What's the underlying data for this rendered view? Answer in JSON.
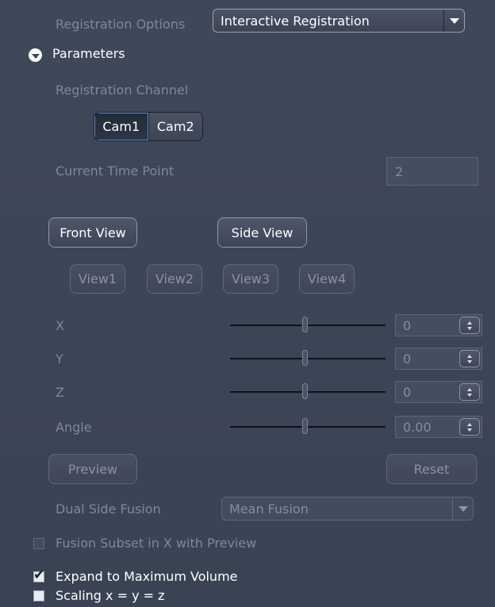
{
  "registration_options": {
    "label": "Registration Options",
    "value": "Interactive Registration"
  },
  "parameters": {
    "title": "Parameters",
    "registration_channel_label": "Registration Channel",
    "channels": [
      "Cam1",
      "Cam2"
    ],
    "selected_channel": "Cam1",
    "current_time_point_label": "Current Time Point",
    "current_time_point_value": "2",
    "front_view_label": "Front View",
    "side_view_label": "Side View",
    "views": [
      "View1",
      "View2",
      "View3",
      "View4"
    ],
    "sliders": [
      {
        "label": "X",
        "value": "0",
        "position": 0.48
      },
      {
        "label": "Y",
        "value": "0",
        "position": 0.48
      },
      {
        "label": "Z",
        "value": "0",
        "position": 0.48
      },
      {
        "label": "Angle",
        "value": "0.00",
        "position": 0.48
      }
    ],
    "preview_label": "Preview",
    "reset_label": "Reset",
    "dual_side_fusion_label": "Dual Side Fusion",
    "dual_side_fusion_value": "Mean Fusion",
    "fusion_subset_label": "Fusion Subset in X with Preview",
    "fusion_subset_checked": false,
    "expand_label": "Expand to Maximum Volume",
    "expand_checked": true,
    "scaling_label": "Scaling x = y = z",
    "scaling_checked": false
  },
  "colors": {
    "background": "#3d4658",
    "disabled_text": "#7f8898",
    "accent": "#5f8bc7"
  }
}
